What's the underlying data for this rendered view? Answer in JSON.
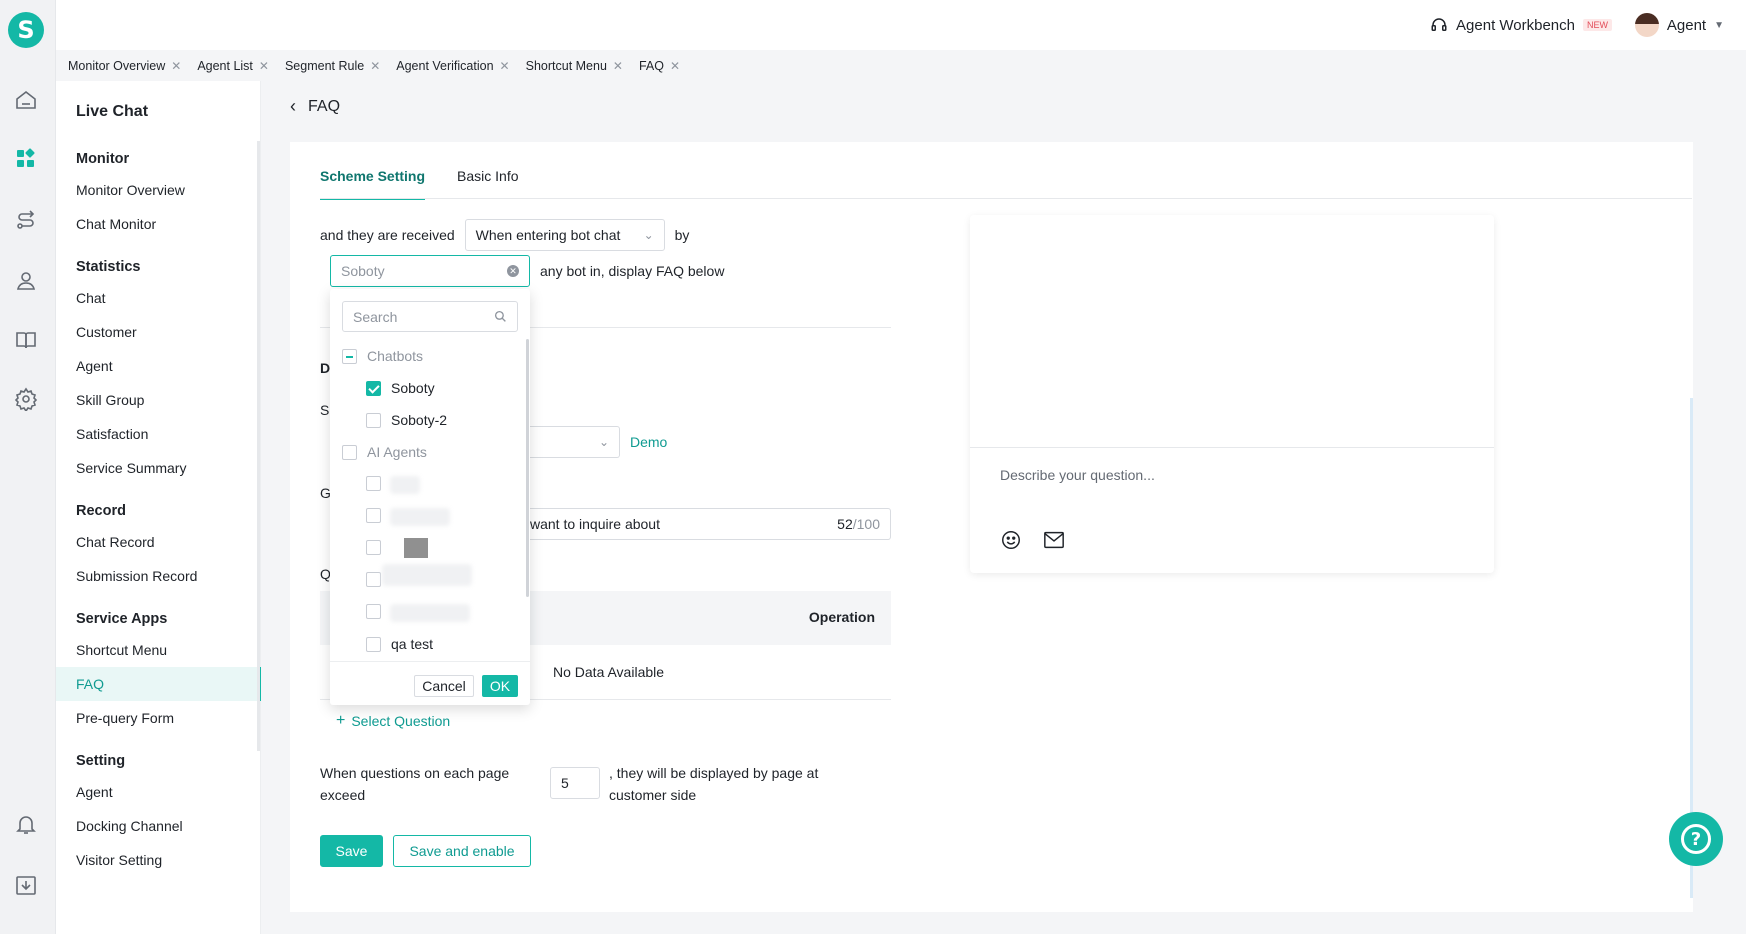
{
  "rail": {
    "logo": "S"
  },
  "header": {
    "workbench": "Agent Workbench",
    "new_badge": "NEW",
    "user": "Agent"
  },
  "tabs": [
    "Monitor Overview",
    "Agent List",
    "Segment Rule",
    "Agent Verification",
    "Shortcut Menu",
    "FAQ"
  ],
  "sidebar": {
    "title": "Live Chat",
    "sections": [
      {
        "title": "Monitor",
        "items": [
          "Monitor Overview",
          "Chat Monitor"
        ]
      },
      {
        "title": "Statistics",
        "items": [
          "Chat",
          "Customer",
          "Agent",
          "Skill Group",
          "Satisfaction",
          "Service Summary"
        ]
      },
      {
        "title": "Record",
        "items": [
          "Chat Record",
          "Submission Record"
        ]
      },
      {
        "title": "Service Apps",
        "items": [
          "Shortcut Menu",
          "FAQ",
          "Pre-query Form"
        ]
      },
      {
        "title": "Setting",
        "items": [
          "Agent",
          "Docking Channel",
          "Visitor Setting"
        ]
      }
    ]
  },
  "page": {
    "title": "FAQ",
    "tab_scheme": "Scheme Setting",
    "tab_basic": "Basic Info"
  },
  "form": {
    "received_label": "and they are received",
    "received_value": "When entering bot chat",
    "by": "by",
    "bot_placeholder": "Soboty",
    "bot_suffix": "any bot in, display FAQ below",
    "s_letter": "S",
    "demo": "Demo",
    "g_letter": "G",
    "greeting_text": "want to inquire about",
    "count": "52",
    "max": "/100",
    "q_letter": "Q",
    "d_letter": "D",
    "operation": "Operation",
    "no_data": "No Data Available",
    "select_question": "Select Question",
    "page_label": "When questions on each page exceed",
    "page_value": "5",
    "page_suffix": ", they will be displayed by page at customer side",
    "save": "Save",
    "save_enable": "Save and enable"
  },
  "dropdown": {
    "search": "Search",
    "group1": "Chatbots",
    "opt1": "Soboty",
    "opt2": "Soboty-2",
    "group2": "AI Agents",
    "opt_last": "qa test",
    "cancel": "Cancel",
    "ok": "OK"
  },
  "preview": {
    "placeholder": "Describe your question..."
  },
  "colors": {
    "accent": "#14b8a6"
  }
}
